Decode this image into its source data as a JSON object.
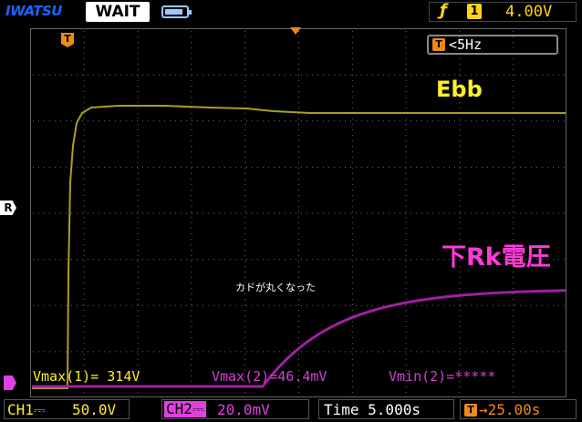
{
  "header": {
    "brand": "IWATSU",
    "state": "WAIT",
    "battery_level": 0.85,
    "trigger_edge_icon": "rising-edge-icon",
    "trigger_channel": "1",
    "trigger_level": "4.00V"
  },
  "screen": {
    "frequency_readout": "<5Hz",
    "trigger_marker": "T",
    "ref_marker": "R",
    "ch2_marker": "",
    "annotations": {
      "ch1_label": "Ebb",
      "ch2_label": "下Rk電圧",
      "note": "カドが丸くなった"
    },
    "measurements": {
      "m1": "Vmax(1)= 314V",
      "m2": "Vmax(2)=46.4mV",
      "m3": "Vmin(2)=*****"
    },
    "colors": {
      "ch1": "#a8a020",
      "ch2": "#a020a0",
      "grid": "#707070",
      "trigger": "#f08a1a"
    }
  },
  "footer": {
    "ch1_name": "CH1⎓",
    "ch1_scale": "50.0V",
    "ch2_name": "CH2⎓",
    "ch2_scale": "20.0mV",
    "timebase": "Time 5.000s",
    "trigger_position": "→25.00s"
  }
}
